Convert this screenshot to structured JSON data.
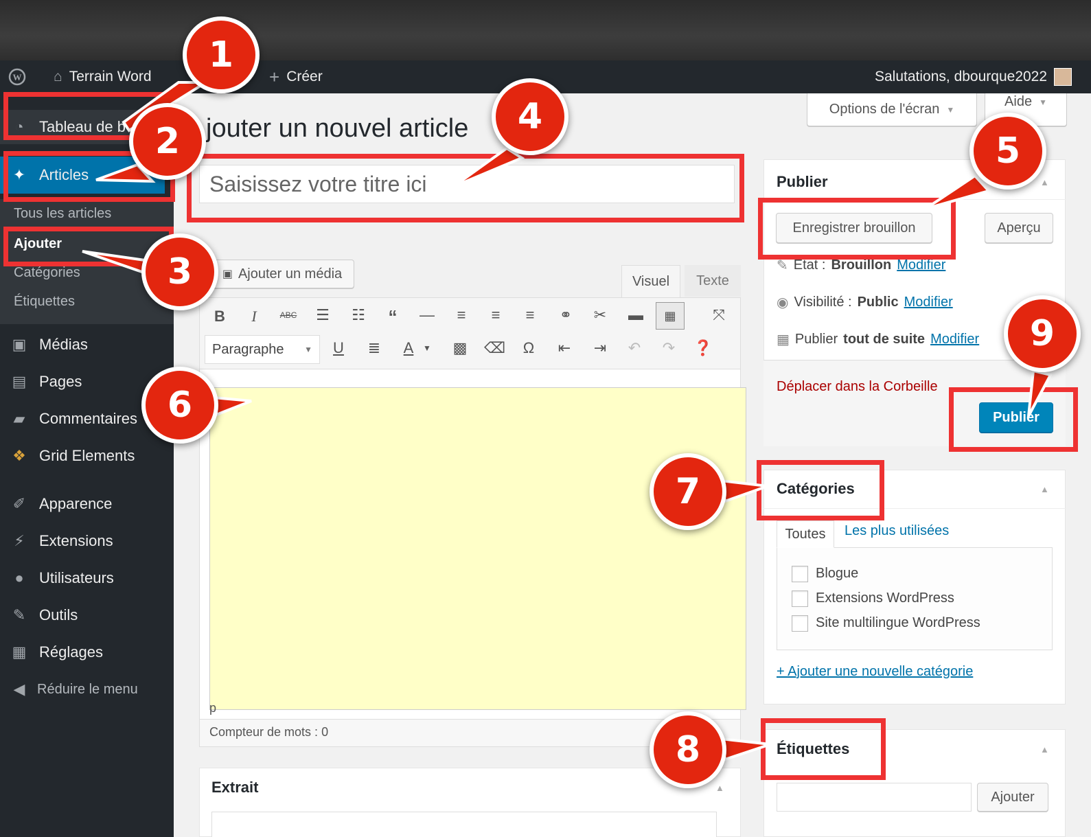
{
  "adminbar": {
    "site_name": "Terrain Word",
    "create": "Créer",
    "greeting": "Salutations, dbourque2022"
  },
  "sidebar": {
    "items": [
      {
        "label": "Tableau de b",
        "icon": "dashboard-icon"
      },
      {
        "label": "Articles",
        "icon": "pin-icon"
      },
      {
        "label": "Médias",
        "icon": "media-icon"
      },
      {
        "label": "Pages",
        "icon": "pages-icon"
      },
      {
        "label": "Commentaires",
        "icon": "comments-icon"
      },
      {
        "label": "Grid Elements",
        "icon": "grid-elements-icon"
      },
      {
        "label": "Apparence",
        "icon": "appearance-icon"
      },
      {
        "label": "Extensions",
        "icon": "plugins-icon"
      },
      {
        "label": "Utilisateurs",
        "icon": "users-icon"
      },
      {
        "label": "Outils",
        "icon": "tools-icon"
      },
      {
        "label": "Réglages",
        "icon": "settings-icon"
      },
      {
        "label": "Réduire le menu",
        "icon": "collapse-icon"
      }
    ],
    "submenu": [
      "Tous les articles",
      "Ajouter",
      "Catégories",
      "Étiquettes"
    ]
  },
  "screen_options": "Options de l'écran",
  "help": "Aide",
  "page_title": "jouter un nouvel article",
  "title_placeholder": "Saisissez votre titre ici",
  "editor": {
    "add_media": "Ajouter un média",
    "tab_visual": "Visuel",
    "tab_text": "Texte",
    "format_select": "Paragraphe",
    "path": "p",
    "word_count": "Compteur de mots : 0"
  },
  "excerpt_title": "Extrait",
  "publish_box": {
    "title": "Publier",
    "save_draft": "Enregistrer brouillon",
    "preview": "Aperçu",
    "status_label": "Etat :",
    "status_value": "Brouillon",
    "visibility_label": "Visibilité :",
    "visibility_value": "Public",
    "schedule_label": "Publier",
    "schedule_value": "tout de suite",
    "edit_link": "Modifier",
    "trash": "Déplacer dans la Corbeille",
    "publish": "Publier"
  },
  "categories_box": {
    "title": "Catégories",
    "tab_all": "Toutes",
    "tab_popular": "Les plus utilisées",
    "items": [
      "Blogue",
      "Extensions WordPress",
      "Site multilingue WordPress"
    ],
    "add_new": "+ Ajouter une nouvelle catégorie"
  },
  "tags_box": {
    "title": "Étiquettes",
    "add": "Ajouter"
  },
  "badges": [
    "1",
    "2",
    "3",
    "4",
    "5",
    "6",
    "7",
    "8",
    "9"
  ],
  "colors": {
    "admin_bar": "#23282d",
    "active_menu": "#0073aa",
    "publish_button": "#0085ba",
    "highlight": "#ee3232",
    "badge": "#e3260f",
    "editor_area": "#ffffc8"
  }
}
